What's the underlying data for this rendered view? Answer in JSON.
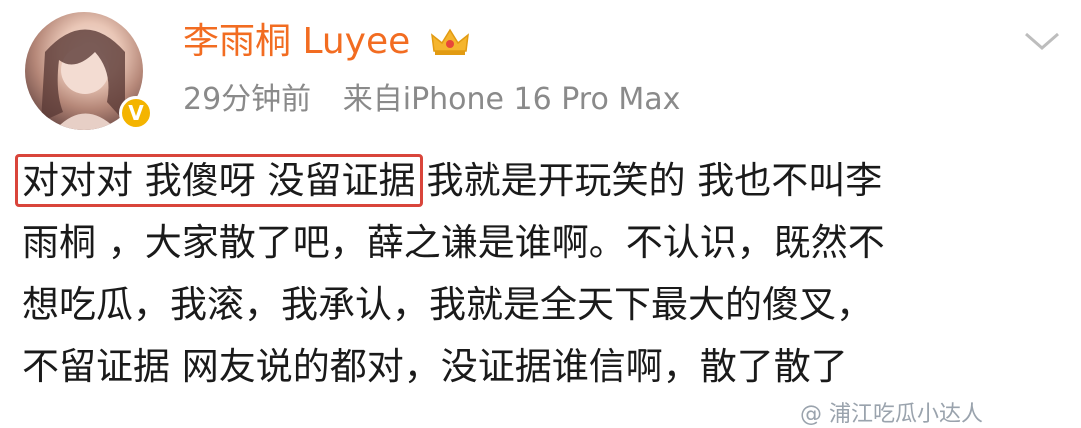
{
  "user": {
    "name": "李雨桐 Luyee",
    "time": "29分钟前",
    "source": "来自iPhone 16 Pro Max",
    "verify_icon": "v-badge-icon",
    "vip_icon": "crown-icon"
  },
  "post": {
    "highlighted": "对对对 我傻呀 没留证据",
    "line1_rest": "我就是开玩笑的 我也不叫李",
    "line2": "雨桐 ，大家散了吧，薛之谦是谁啊。不认识，既然不",
    "line3": "想吃瓜，我滚，我承认，我就是全天下最大的傻叉，",
    "line4": "不留证据 网友说的都对，没证据谁信啊，散了散了"
  },
  "watermark": "@ 浦江吃瓜小达人",
  "colors": {
    "username": "#f26c21",
    "meta": "#8a8a8a",
    "highlight_border": "#d9453b",
    "badge": "#f4b400"
  }
}
